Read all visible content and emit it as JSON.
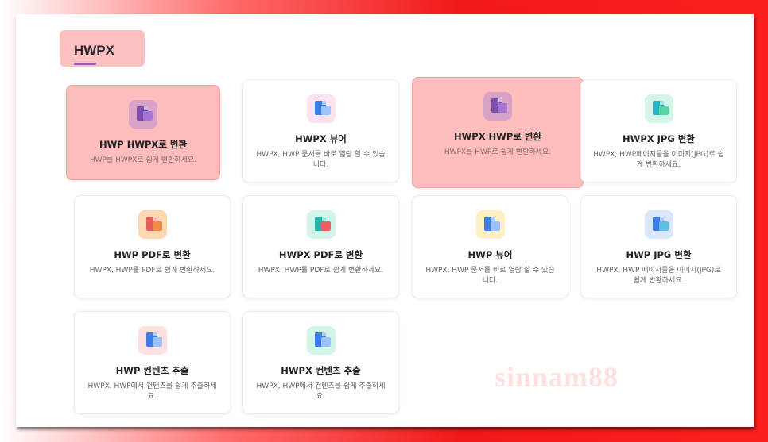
{
  "section": {
    "title": "HWPX"
  },
  "cards": [
    {
      "title": "HWP HWPX로 변환",
      "desc": "HWP를 HWPX로 쉽게 변환하세요.",
      "icon": "convert-doc-icon",
      "icon_bg": "#d9a3c8",
      "doc": "#7b4fb0",
      "badge": "#a574d4",
      "highlight": true
    },
    {
      "title": "HWPX 뷰어",
      "desc": "HWPX, HWP 문서를 바로 열람 할 수 있습니다.",
      "icon": "viewer-doc-icon",
      "icon_bg": "#fde3ef",
      "doc": "#3c7ee6",
      "badge": "#9cc3ff",
      "highlight": false
    },
    {
      "title": "HWPX HWP로 변환",
      "desc": "HWPX를 HWP로 쉽게 변환하세요.",
      "icon": "convert-doc-icon",
      "icon_bg": "#d9a3c8",
      "doc": "#7b4fb0",
      "badge": "#a574d4",
      "highlight": true
    },
    {
      "title": "HWPX JPG 변환",
      "desc": "HWPX, HWP페이지들을 이미지(JPG)로 쉽게 변환하세요.",
      "icon": "image-doc-icon",
      "icon_bg": "#d4f5e7",
      "doc": "#26b3c4",
      "badge": "#58d4a8",
      "highlight": false
    },
    {
      "title": "HWP PDF로 변환",
      "desc": "HWPX, HWP를 PDF로 쉽게 변환하세요.",
      "icon": "pdf-doc-icon",
      "icon_bg": "#fdd8b0",
      "doc": "#e85a5a",
      "badge": "#f08a4b",
      "highlight": false
    },
    {
      "title": "HWPX PDF로 변환",
      "desc": "HWPX, HWP를 PDF로 쉽게 변환하세요.",
      "icon": "pdf-doc-icon",
      "icon_bg": "#d2f5ea",
      "doc": "#24b5a8",
      "badge": "#ef5e5e",
      "highlight": false
    },
    {
      "title": "HWP 뷰어",
      "desc": "HWPX, HWP 문서를 바로 열람 할 수 있습니다.",
      "icon": "viewer-doc-icon",
      "icon_bg": "#fdf0c2",
      "doc": "#3c7ee6",
      "badge": "#9cc3ff",
      "highlight": false
    },
    {
      "title": "HWP JPG 변환",
      "desc": "HWPX, HWP 페이지들을 이미지(JPG)로 쉽게 변환하세요.",
      "icon": "image-doc-icon",
      "icon_bg": "#dbe8fb",
      "doc": "#3c7ee6",
      "badge": "#5ac2e8",
      "highlight": false
    },
    {
      "title": "HWP 컨텐츠 추출",
      "desc": "HWPX, HWP에서 컨텐츠를 쉽게 추출하세요.",
      "icon": "extract-content-icon",
      "icon_bg": "#fde0e0",
      "doc": "#3c7ee6",
      "badge": "#9cc3ff",
      "highlight": false
    },
    {
      "title": "HWPX 컨텐츠 추출",
      "desc": "HWPX, HWP에서 컨텐츠를 쉽게 추출하세요.",
      "icon": "extract-content-icon",
      "icon_bg": "#d2f5ea",
      "doc": "#3c7ee6",
      "badge": "#9cc3ff",
      "highlight": false
    }
  ],
  "watermark": "sinnam88"
}
